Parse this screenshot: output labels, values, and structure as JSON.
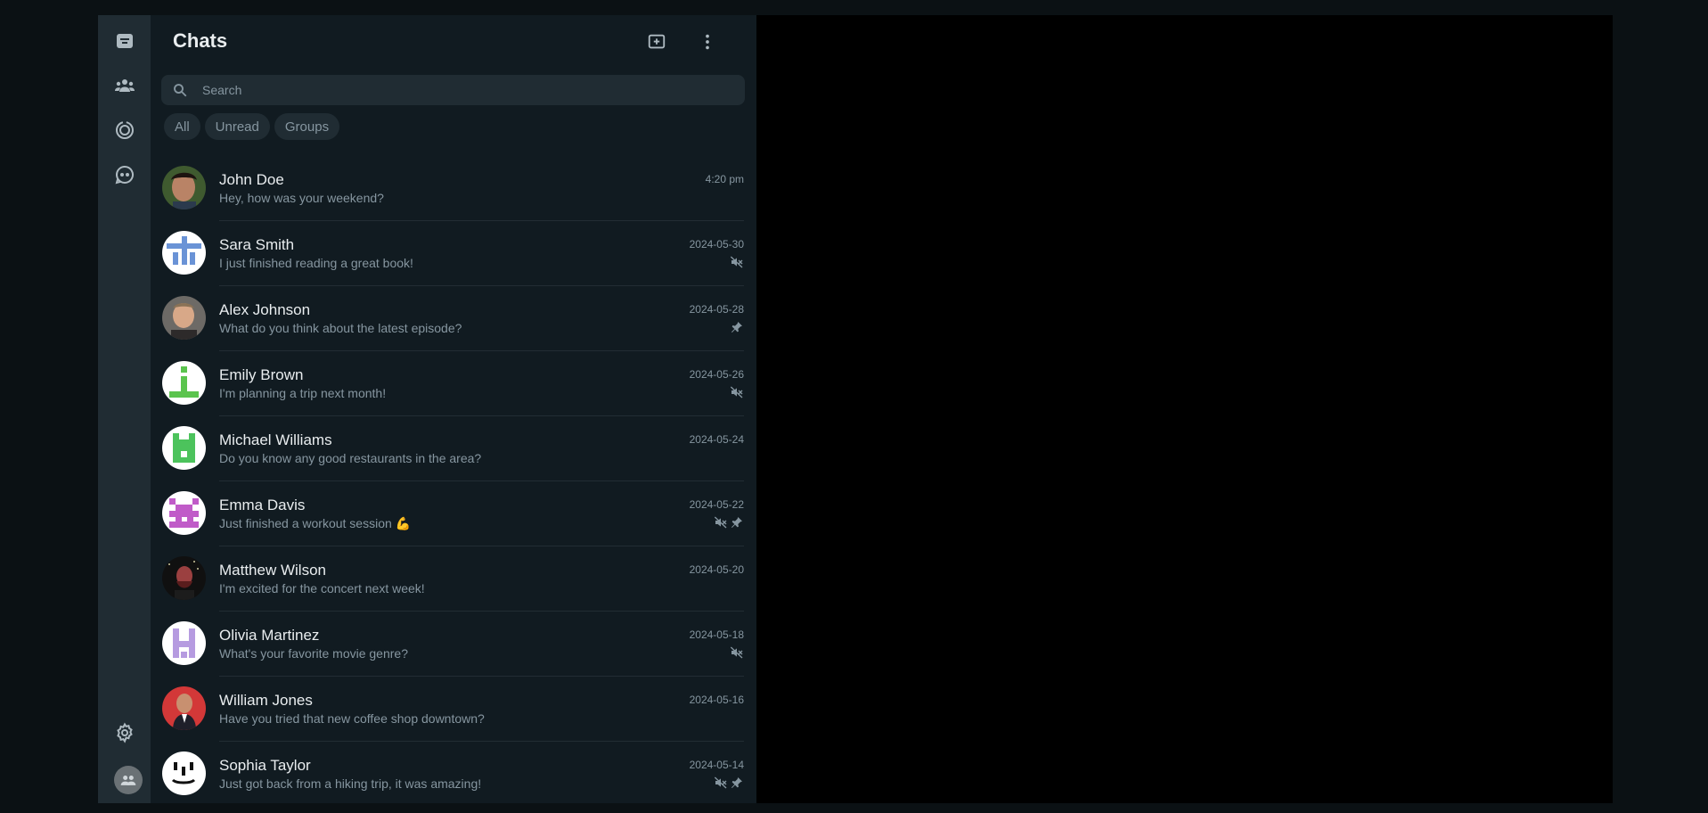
{
  "panel": {
    "title": "Chats",
    "new_chat_icon": "new-chat-icon",
    "menu_icon": "kebab-menu-icon"
  },
  "search": {
    "placeholder": "Search",
    "icon": "search-icon"
  },
  "filters": [
    {
      "label": "All"
    },
    {
      "label": "Unread"
    },
    {
      "label": "Groups"
    }
  ],
  "rail": {
    "icons": [
      "chats-icon",
      "communities-icon",
      "status-icon",
      "channels-icon",
      "settings-icon",
      "profile-avatar-icon"
    ]
  },
  "chats": [
    {
      "name": "John Doe",
      "preview": "Hey, how was your weekend?",
      "time": "4:20 pm",
      "muted": false,
      "pinned": false
    },
    {
      "name": "Sara Smith",
      "preview": "I just finished reading a great book!",
      "time": "2024-05-30",
      "muted": true,
      "pinned": false
    },
    {
      "name": "Alex Johnson",
      "preview": "What do you think about the latest episode?",
      "time": "2024-05-28",
      "muted": false,
      "pinned": true
    },
    {
      "name": "Emily Brown",
      "preview": "I'm planning a trip next month!",
      "time": "2024-05-26",
      "muted": true,
      "pinned": false
    },
    {
      "name": "Michael Williams",
      "preview": "Do you know any good restaurants in the area?",
      "time": "2024-05-24",
      "muted": false,
      "pinned": false
    },
    {
      "name": "Emma Davis",
      "preview": "Just finished a workout session 💪",
      "time": "2024-05-22",
      "muted": true,
      "pinned": true
    },
    {
      "name": "Matthew Wilson",
      "preview": "I'm excited for the concert next week!",
      "time": "2024-05-20",
      "muted": false,
      "pinned": false
    },
    {
      "name": "Olivia Martinez",
      "preview": "What's your favorite movie genre?",
      "time": "2024-05-18",
      "muted": true,
      "pinned": false
    },
    {
      "name": "William Jones",
      "preview": "Have you tried that new coffee shop downtown?",
      "time": "2024-05-16",
      "muted": false,
      "pinned": false
    },
    {
      "name": "Sophia Taylor",
      "preview": "Just got back from a hiking trip, it was amazing!",
      "time": "2024-05-14",
      "muted": true,
      "pinned": true
    }
  ],
  "colors": {
    "rail_bg": "#202c33",
    "panel_bg": "#111b21",
    "text_primary": "#e9edef",
    "text_secondary": "#8696a0",
    "viewer_bg": "#000000"
  }
}
